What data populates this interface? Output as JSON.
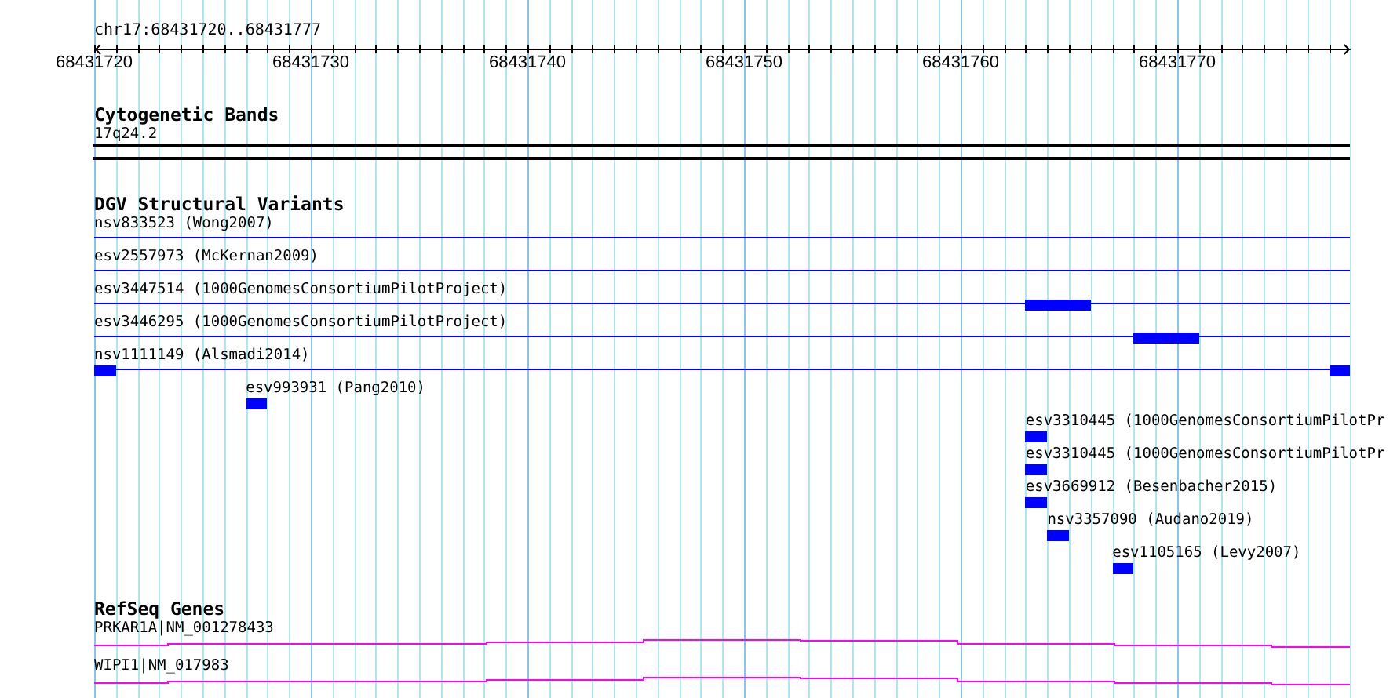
{
  "ruler": {
    "title": "chr17:68431720..68431777",
    "labels": [
      "68431720",
      "68431730",
      "68431740",
      "68431750",
      "68431760",
      "68431770"
    ]
  },
  "tracks": [
    {
      "kind": "bands",
      "title": "Cytogenetic Bands",
      "features": [
        {
          "label": "17q24.2"
        }
      ]
    },
    {
      "kind": "variants",
      "title": "DGV Structural Variants",
      "features": [
        {
          "label": "nsv833523 (Wong2007)",
          "span": true
        },
        {
          "label": "esv2557973 (McKernan2009)",
          "span": true
        },
        {
          "label": "esv3447514 (1000GenomesConsortiumPilotProject)",
          "span": true
        },
        {
          "label": "esv3446295 (1000GenomesConsortiumPilotProject)",
          "span": true
        },
        {
          "label": "nsv1111149 (Alsmadi2014)",
          "span": true
        },
        {
          "label": "esv993931 (Pang2010)",
          "span": false
        },
        {
          "label": "esv3310445 (1000GenomesConsortiumPilotPr",
          "span": false
        },
        {
          "label": "esv3310445 (1000GenomesConsortiumPilotPr",
          "span": false
        },
        {
          "label": "esv3669912 (Besenbacher2015)",
          "span": false
        },
        {
          "label": "nsv3357090 (Audano2019)",
          "span": false
        },
        {
          "label": "esv1105165 (Levy2007)",
          "span": false
        }
      ]
    },
    {
      "kind": "genes",
      "title": "RefSeq Genes",
      "features": [
        {
          "label": "PRKAR1A|NM_001278433"
        },
        {
          "label": "WIPI1|NM_017983"
        }
      ]
    }
  ]
}
